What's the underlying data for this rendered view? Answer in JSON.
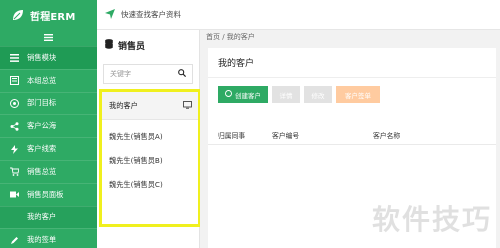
{
  "app": {
    "brand": "哲程ERM"
  },
  "topbar": {
    "label": "快速查找客户资料"
  },
  "sidebar": {
    "items": [
      {
        "label": "销售模块",
        "icon": "list-icon"
      },
      {
        "label": "本组总览",
        "icon": "report-icon"
      },
      {
        "label": "部门目标",
        "icon": "target-icon"
      },
      {
        "label": "客户公海",
        "icon": "share-icon"
      },
      {
        "label": "客户线索",
        "icon": "bolt-icon"
      },
      {
        "label": "销售总览",
        "icon": "cart-icon"
      },
      {
        "label": "销售员面板",
        "icon": "video-icon"
      },
      {
        "label": "我的客户",
        "icon": ""
      },
      {
        "label": "我的签单",
        "icon": "sign-icon"
      }
    ]
  },
  "panel": {
    "title": "销售员",
    "search_placeholder": "关键字",
    "mine": "我的客户",
    "people": [
      "魏先生(销售员A)",
      "魏先生(销售员B)",
      "魏先生(销售员C)"
    ]
  },
  "main": {
    "breadcrumb": "首页 / 我的客户",
    "title": "我的客户",
    "buttons": {
      "create": "创建客户",
      "detail": "详情",
      "edit": "修改",
      "sign": "客户签单"
    },
    "columns": [
      "归属同事",
      "客户编号",
      "客户名称"
    ]
  },
  "watermark": "软件技巧",
  "colors": {
    "primary": "#2eaa64",
    "highlight": "#f0f01e"
  }
}
